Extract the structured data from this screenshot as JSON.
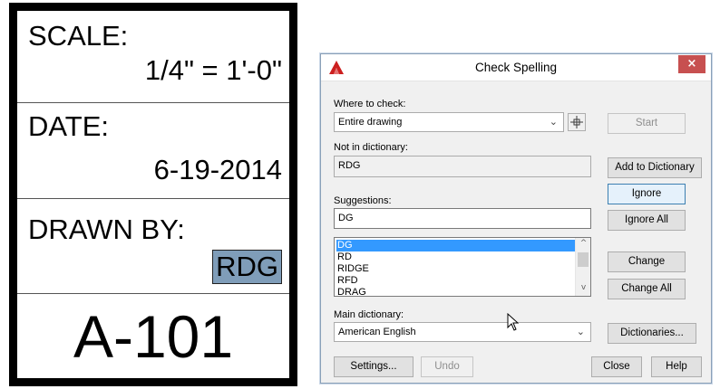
{
  "title_block": {
    "scale_label": "SCALE:",
    "scale_value": "1/4\" = 1'-0\"",
    "date_label": "DATE:",
    "date_value": "6-19-2014",
    "drawn_by_label": "DRAWN BY:",
    "drawn_by_value": "RDG",
    "sheet_number": "A-101"
  },
  "dialog": {
    "title": "Check Spelling",
    "close_glyph": "×",
    "where_label": "Where to check:",
    "where_value": "Entire drawing",
    "not_in_dict_label": "Not in dictionary:",
    "not_in_dict_value": "RDG",
    "suggestions_label": "Suggestions:",
    "suggestion_value": "DG",
    "suggestions_list": [
      "DG",
      "RD",
      "RIDGE",
      "RFD",
      "DRAG"
    ],
    "selected_index": 0,
    "main_dict_label": "Main dictionary:",
    "main_dict_value": "American English",
    "buttons": {
      "start": "Start",
      "add_to_dictionary": "Add to Dictionary",
      "ignore": "Ignore",
      "ignore_all": "Ignore All",
      "change": "Change",
      "change_all": "Change All",
      "dictionaries": "Dictionaries...",
      "settings": "Settings...",
      "undo": "Undo",
      "close": "Close",
      "help": "Help"
    },
    "chevron": "⌄",
    "scroll_up": "^",
    "scroll_down": "v"
  },
  "colors": {
    "highlight": "#7f9db9",
    "selection": "#3399ff",
    "close_button": "#c75050",
    "app_icon": "#cc1f1f"
  },
  "icons": [
    "autocad-logo-icon",
    "close-icon",
    "chevron-down-icon",
    "pick-objects-icon",
    "mouse-cursor-icon"
  ]
}
